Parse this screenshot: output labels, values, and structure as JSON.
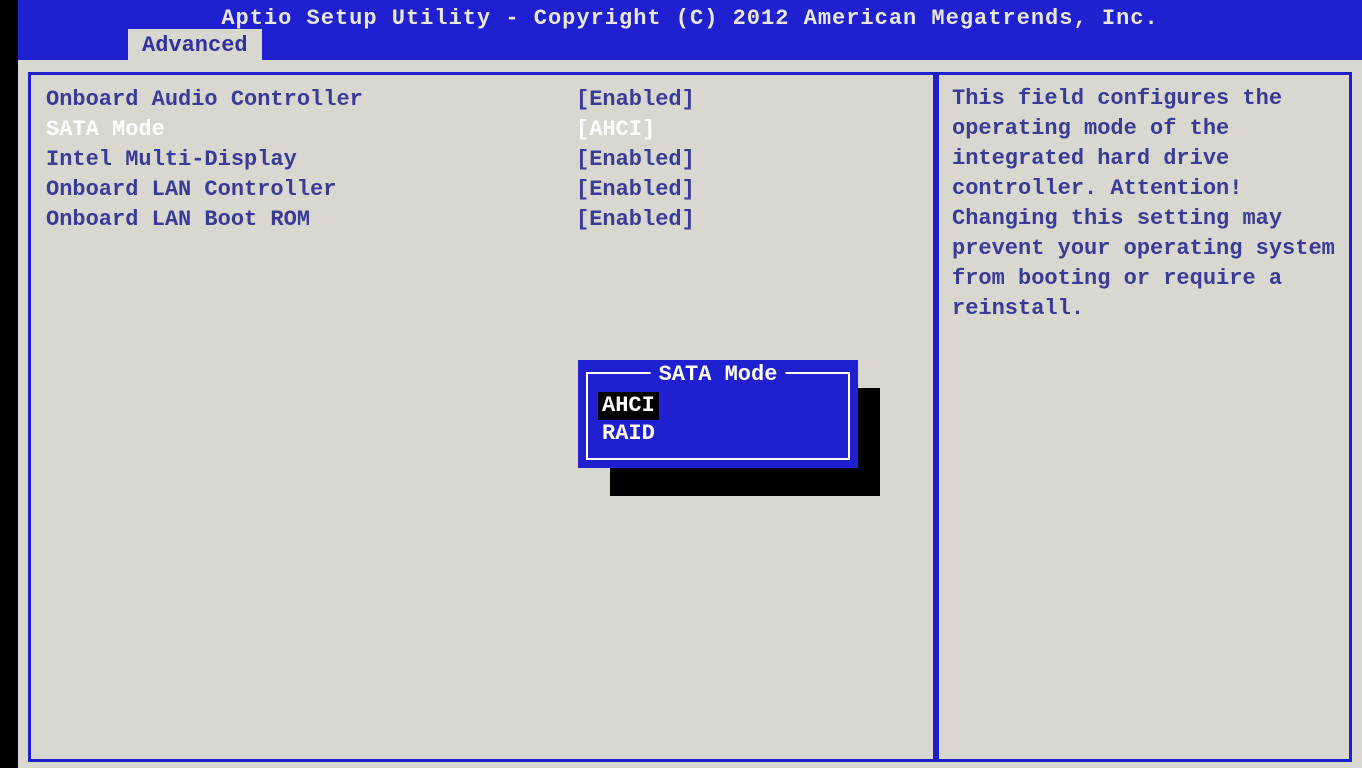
{
  "header": {
    "title": "Aptio Setup Utility - Copyright (C) 2012 American Megatrends, Inc.",
    "active_tab": "Advanced"
  },
  "settings": [
    {
      "label": "Onboard Audio Controller",
      "value": "[Enabled]",
      "selected": false
    },
    {
      "label": "SATA Mode",
      "value": "[AHCI]",
      "selected": true
    },
    {
      "label": "Intel Multi-Display",
      "value": "[Enabled]",
      "selected": false
    },
    {
      "label": "Onboard LAN Controller",
      "value": "[Enabled]",
      "selected": false
    },
    {
      "label": "Onboard LAN Boot ROM",
      "value": "[Enabled]",
      "selected": false
    }
  ],
  "help": {
    "text": "This field configures the operating mode of the integrated hard drive controller.\nAttention! Changing this setting may prevent your operating system from booting or require a reinstall."
  },
  "popup": {
    "title": "SATA Mode",
    "options": [
      {
        "label": "AHCI",
        "selected": true
      },
      {
        "label": "RAID",
        "selected": false
      }
    ]
  }
}
